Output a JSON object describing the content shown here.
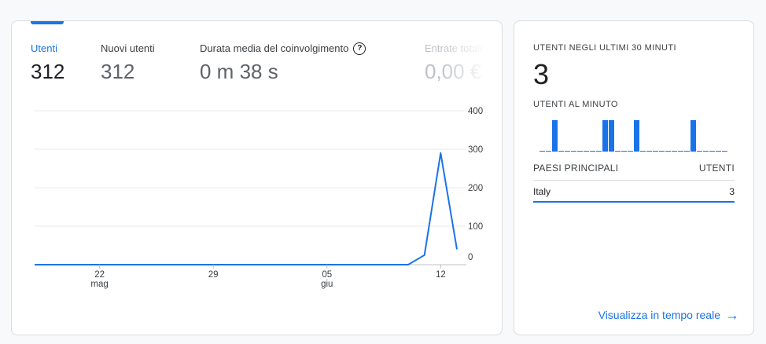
{
  "summary": {
    "metrics": [
      {
        "label": "Utenti",
        "value": "312"
      },
      {
        "label": "Nuovi utenti",
        "value": "312"
      },
      {
        "label": "Durata media del coinvolgimento",
        "value": "0 m 38 s"
      },
      {
        "label": "Entrate totali",
        "value": "0,00 €"
      }
    ],
    "help_glyph": "?"
  },
  "chart_data": {
    "type": "line",
    "series": [
      {
        "values": [
          0,
          0,
          0,
          0,
          0,
          0,
          0,
          0,
          0,
          0,
          0,
          0,
          0,
          0,
          0,
          0,
          0,
          0,
          0,
          0,
          0,
          0,
          0,
          0,
          25,
          290,
          40
        ]
      }
    ],
    "x_ticks": [
      {
        "index": 4,
        "day": "22",
        "month": "mag"
      },
      {
        "index": 11,
        "day": "29",
        "month": ""
      },
      {
        "index": 18,
        "day": "05",
        "month": "giu"
      },
      {
        "index": 25,
        "day": "12",
        "month": ""
      }
    ],
    "y_ticks": [
      0,
      100,
      200,
      300,
      400
    ],
    "ylim": [
      0,
      400
    ],
    "grid": true,
    "color": "#1a73e8"
  },
  "realtime": {
    "title": "UTENTI NEGLI ULTIMI 30 MINUTI",
    "value": "3",
    "per_minute_label": "UTENTI AL MINUTO",
    "per_minute": [
      0,
      0,
      1,
      0,
      0,
      0,
      0,
      0,
      0,
      0,
      1,
      1,
      0,
      0,
      0,
      1,
      0,
      0,
      0,
      0,
      0,
      0,
      0,
      0,
      1,
      0,
      0,
      0,
      0,
      0
    ],
    "countries_header": "PAESI PRINCIPALI",
    "users_header": "UTENTI",
    "countries": [
      {
        "name": "Italy",
        "users": "3"
      }
    ],
    "link_label": "Visualizza in tempo reale",
    "accent": "#1a73e8"
  }
}
